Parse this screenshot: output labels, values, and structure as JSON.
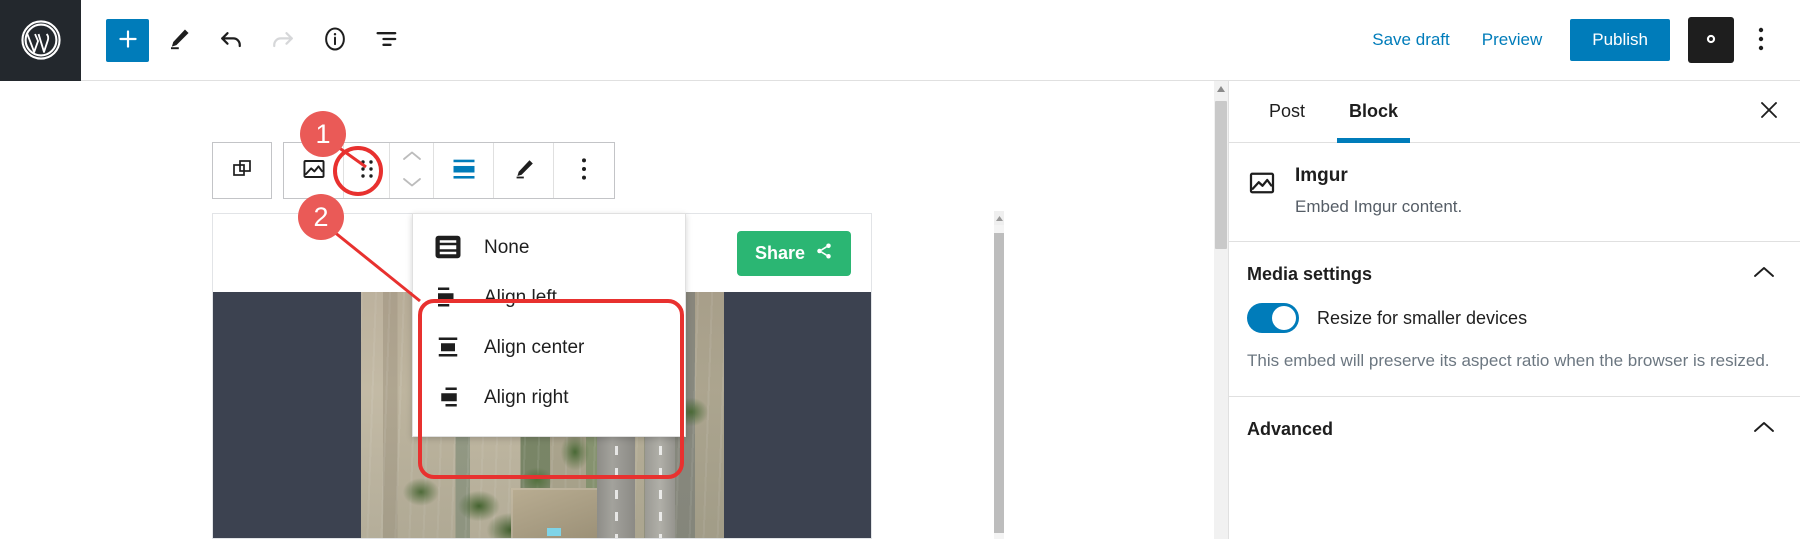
{
  "topbar": {
    "logo_icon": "wordpress-logo-icon",
    "add_label": "+",
    "tools": [
      {
        "name": "add-block-button",
        "icon": "plus-icon"
      },
      {
        "name": "edit-tool-button",
        "icon": "pencil-icon"
      },
      {
        "name": "undo-button",
        "icon": "undo-arrow-icon"
      },
      {
        "name": "redo-button",
        "icon": "redo-arrow-icon"
      },
      {
        "name": "details-button",
        "icon": "info-circle-icon"
      },
      {
        "name": "list-view-button",
        "icon": "list-view-icon"
      }
    ],
    "save_draft_label": "Save draft",
    "preview_label": "Preview",
    "publish_label": "Publish",
    "settings_icon": "gear-icon",
    "options_icon": "kebab-menu-icon"
  },
  "block_toolbar": {
    "parent_block_icon": "parent-block-layers-icon",
    "block_type_icon": "image-embed-icon",
    "drag_handle_icon": "drag-dots-icon",
    "move_up_icon": "chevron-up-icon",
    "move_down_icon": "chevron-down-icon",
    "align_icon": "align-none-icon",
    "edit_icon": "pencil-icon",
    "more_options_icon": "kebab-menu-icon"
  },
  "align_menu": {
    "items": [
      {
        "label": "None",
        "icon": "align-none-icon",
        "selected": true
      },
      {
        "label": "Align left",
        "icon": "align-left-icon",
        "selected": false
      },
      {
        "label": "Align center",
        "icon": "align-center-icon",
        "selected": false
      },
      {
        "label": "Align right",
        "icon": "align-right-icon",
        "selected": false
      }
    ]
  },
  "annotations": [
    {
      "number": "1",
      "target": "align-toolbar-button"
    },
    {
      "number": "2",
      "target": "align-dropdown-menu"
    }
  ],
  "embed": {
    "share_label": "Share",
    "share_icon": "share-network-icon",
    "media_alt": "aerial-satellite-photo"
  },
  "sidebar": {
    "tabs": [
      {
        "label": "Post",
        "active": false
      },
      {
        "label": "Block",
        "active": true
      }
    ],
    "close_icon": "close-icon",
    "block": {
      "icon": "image-embed-icon",
      "title": "Imgur",
      "description": "Embed Imgur content."
    },
    "panels": [
      {
        "title": "Media settings",
        "chevron_icon": "chevron-up-icon",
        "toggle_label": "Resize for smaller devices",
        "toggle_on": true,
        "help_text": "This embed will preserve its aspect ratio when the browser is resized."
      },
      {
        "title": "Advanced",
        "chevron_icon": "chevron-up-icon"
      }
    ]
  },
  "colors": {
    "accent_blue": "#007cba",
    "dark": "#1e1e1e",
    "annotation_red": "#e8312f",
    "badge_red": "#ea5a57",
    "share_green": "#2bb673"
  }
}
